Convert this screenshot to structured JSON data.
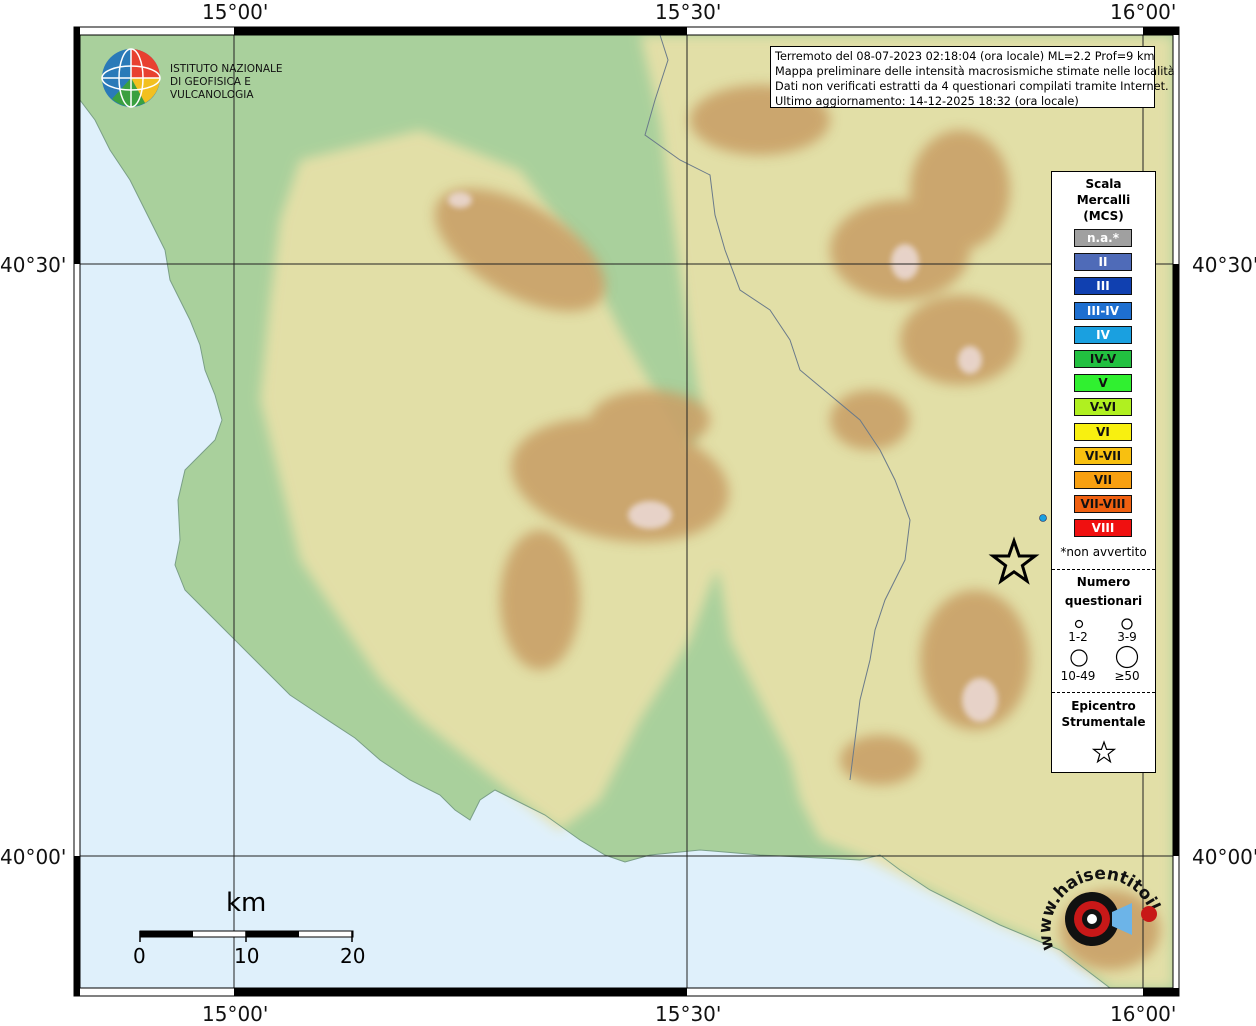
{
  "header": {
    "line1": "Terremoto del 08-07-2023 02:18:04 (ora locale) ML=2.2 Prof=9 km",
    "line2": "Mappa preliminare delle intensità macrosismiche stimate nelle località",
    "line3": "Dati non verificati estratti da 4 questionari compilati tramite Internet.",
    "line4": "Ultimo aggiornamento: 14-12-2025 18:32 (ora locale)"
  },
  "logo": {
    "line1": "ISTITUTO NAZIONALE",
    "line2": "DI GEOFISICA E VULCANOLOGIA",
    "icon": "ingv-globe-icon"
  },
  "axes": {
    "top": [
      "15°00'",
      "15°30'",
      "16°00'"
    ],
    "bottom": [
      "15°00'",
      "15°30'",
      "16°00'"
    ],
    "left": [
      "40°30'",
      "40°00'"
    ],
    "right": [
      "40°30'",
      "40°00'"
    ]
  },
  "legend": {
    "title_line1": "Scala",
    "title_line2": "Mercalli",
    "title_line3": "(MCS)",
    "intensities": [
      {
        "label": "n.a.*",
        "color": "#a0a0a0",
        "text_color": "#ffffff"
      },
      {
        "label": "II",
        "color": "#4f6bb8",
        "text_color": "#ffffff"
      },
      {
        "label": "III",
        "color": "#1040b0",
        "text_color": "#ffffff"
      },
      {
        "label": "III-IV",
        "color": "#1e6fd0",
        "text_color": "#ffffff"
      },
      {
        "label": "IV",
        "color": "#1aa0e0",
        "text_color": "#ffffff"
      },
      {
        "label": "IV-V",
        "color": "#22c040",
        "text_color": "#111111"
      },
      {
        "label": "V",
        "color": "#30f030",
        "text_color": "#111111"
      },
      {
        "label": "V-VI",
        "color": "#b0f020",
        "text_color": "#111111"
      },
      {
        "label": "VI",
        "color": "#f8f010",
        "text_color": "#111111"
      },
      {
        "label": "VI-VII",
        "color": "#f8c010",
        "text_color": "#111111"
      },
      {
        "label": "VII",
        "color": "#f8a010",
        "text_color": "#111111"
      },
      {
        "label": "VII-VIII",
        "color": "#f06010",
        "text_color": "#111111"
      },
      {
        "label": "VIII",
        "color": "#f01010",
        "text_color": "#ffffff"
      }
    ],
    "not_felt": "*non avvertito",
    "count_title_line1": "Numero",
    "count_title_line2": "questionari",
    "count_classes": [
      "1-2",
      "3-9",
      "10-49",
      "≥50"
    ],
    "epicenter_title_line1": "Epicentro",
    "epicenter_title_line2": "Strumentale"
  },
  "scale_bar": {
    "unit": "km",
    "ticks": [
      "0",
      "10",
      "20"
    ]
  },
  "observations": [
    {
      "intensity": "IV",
      "color": "#1aa0e0",
      "count_class": "1-2"
    }
  ],
  "badge": {
    "text": "www.haisentitoilterremoto.it"
  },
  "colors": {
    "sea": "#dff0fb",
    "lowland": "#a8cf9a",
    "hills": "#e6dfa6",
    "mountains": "#c49d61",
    "peaks": "#e8d8d0"
  }
}
